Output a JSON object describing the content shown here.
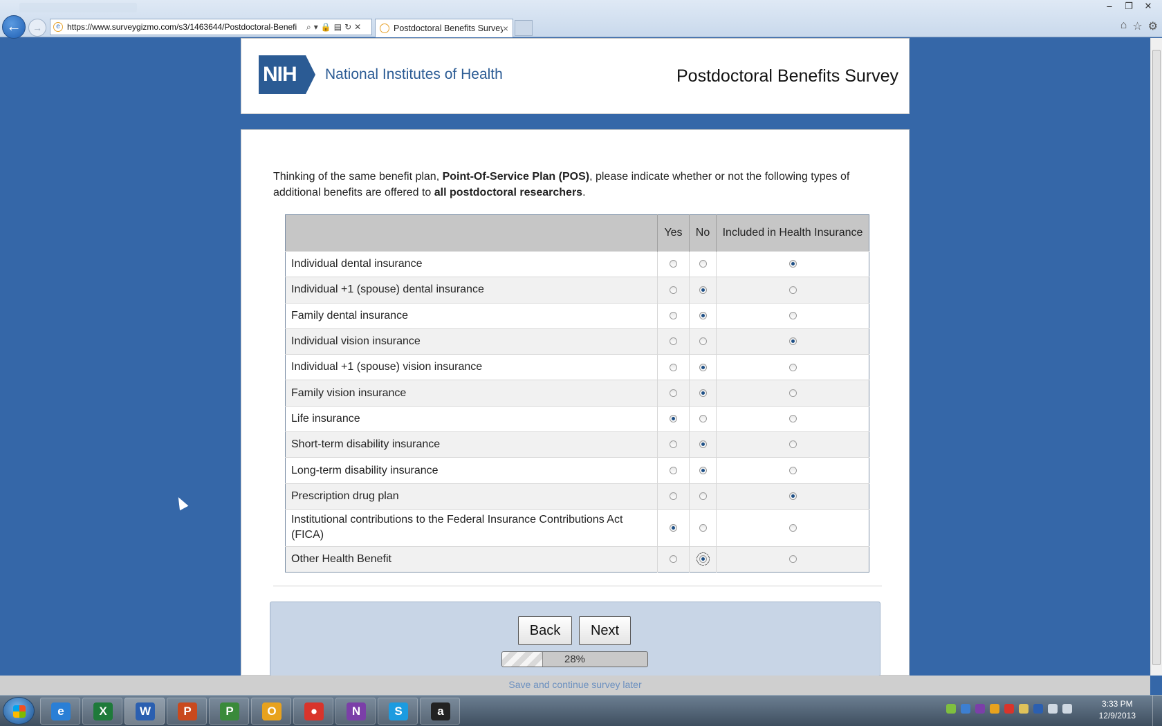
{
  "browser": {
    "url": "https://www.surveygizmo.com/s3/1463644/Postdoctoral-Benefi",
    "tab_title": "Postdoctoral Benefits Survey",
    "tab_close": "×",
    "back_glyph": "←",
    "forward_glyph": "→"
  },
  "header": {
    "logo_mark": "NIH",
    "logo_name": "National Institutes of Health",
    "survey_title": "Postdoctoral Benefits Survey"
  },
  "question": {
    "text_1": "Thinking of the same benefit plan, ",
    "plan_name": "Point-Of-Service Plan (POS)",
    "text_2": ", please indicate whether or not the following types of additional benefits are offered to ",
    "audience": "all postdoctoral researchers",
    "text_3": "."
  },
  "grid": {
    "columns": [
      "Yes",
      "No",
      "Included in Health Insurance"
    ],
    "rows": [
      {
        "label": "Individual dental insurance",
        "selected": 2
      },
      {
        "label": "Individual +1 (spouse) dental insurance",
        "selected": 1
      },
      {
        "label": "Family dental insurance",
        "selected": 1
      },
      {
        "label": "Individual vision insurance",
        "selected": 2
      },
      {
        "label": "Individual +1 (spouse) vision insurance",
        "selected": 1
      },
      {
        "label": "Family vision insurance",
        "selected": 1
      },
      {
        "label": "Life insurance",
        "selected": 0
      },
      {
        "label": "Short-term disability insurance",
        "selected": 1
      },
      {
        "label": "Long-term disability insurance",
        "selected": 1
      },
      {
        "label": "Prescription drug plan",
        "selected": 2
      },
      {
        "label": "Institutional contributions to the Federal Insurance Contributions Act (FICA)",
        "selected": 0
      },
      {
        "label": "Other Health Benefit",
        "selected": 1,
        "focused": true
      }
    ]
  },
  "navigation": {
    "back_label": "Back",
    "next_label": "Next",
    "progress_value": 0.28,
    "progress_text": "28%",
    "save_later_label": "Save and continue survey later"
  },
  "taskbar": {
    "apps": [
      "Internet Explorer",
      "Excel",
      "Word",
      "PowerPoint",
      "Project",
      "Outlook",
      "Chrome",
      "OneNote",
      "Skype",
      "Amazon"
    ],
    "clock_time": "3:33 PM",
    "clock_date": "12/9/2013"
  },
  "colors": {
    "page_background": "#3567a8",
    "nih_blue": "#2b5b94",
    "radio_dot": "#1d4f86"
  }
}
